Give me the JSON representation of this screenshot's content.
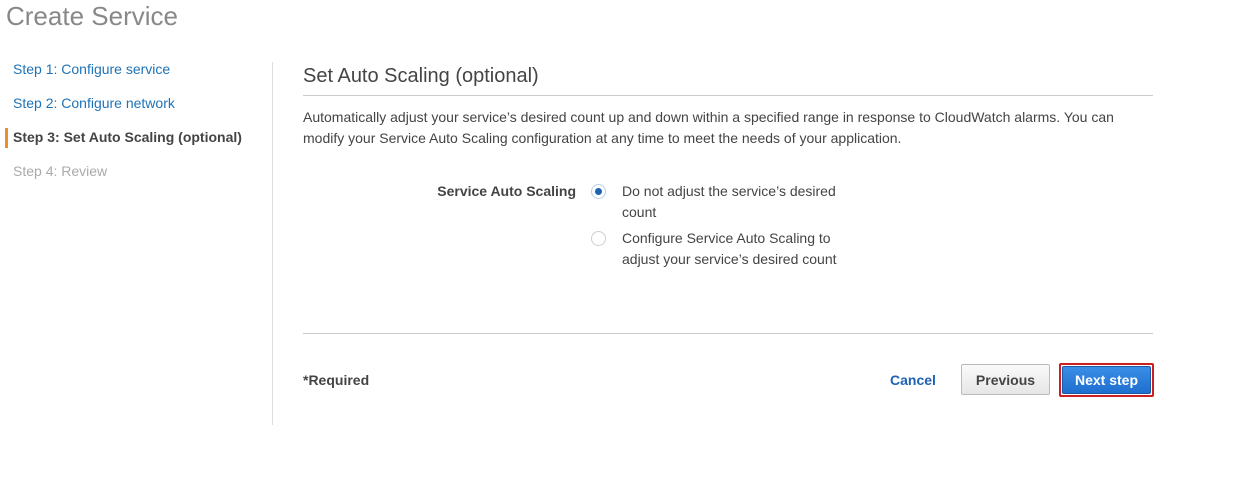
{
  "page": {
    "title": "Create Service"
  },
  "steps": [
    {
      "label": "Step 1: Configure service",
      "state": "link"
    },
    {
      "label": "Step 2: Configure network",
      "state": "link"
    },
    {
      "label": "Step 3: Set Auto Scaling (optional)",
      "state": "current"
    },
    {
      "label": "Step 4: Review",
      "state": "disabled"
    }
  ],
  "section": {
    "title": "Set Auto Scaling (optional)",
    "description": "Automatically adjust your service’s desired count up and down within a specified range in response to CloudWatch alarms. You can modify your Service Auto Scaling configuration at any time to meet the needs of your application."
  },
  "auto_scaling": {
    "label": "Service Auto Scaling",
    "options": [
      {
        "label": "Do not adjust the service’s desired count",
        "selected": true
      },
      {
        "label": "Configure Service Auto Scaling to adjust your service’s desired count",
        "selected": false
      }
    ]
  },
  "footer": {
    "required_note": "*Required",
    "cancel_label": "Cancel",
    "previous_label": "Previous",
    "next_label": "Next step"
  },
  "colors": {
    "link": "#1e73b8",
    "active_step_marker": "#e8912a",
    "primary_button": "#1e6fcf",
    "highlight_border": "#cc1f1f"
  }
}
